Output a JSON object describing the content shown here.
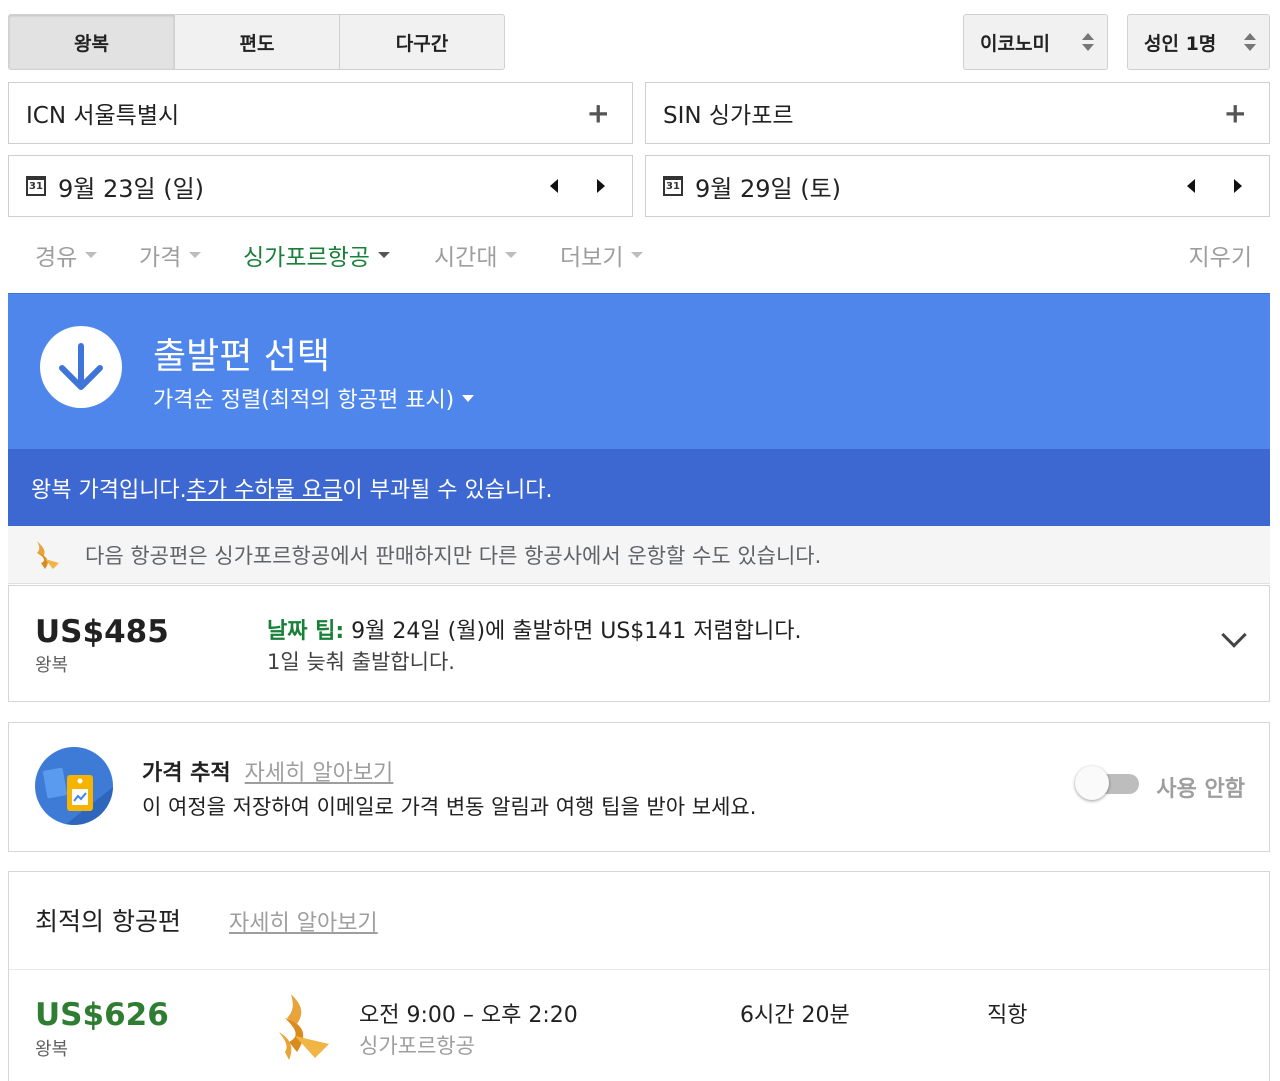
{
  "trip_tabs": [
    "왕복",
    "편도",
    "다구간"
  ],
  "cabin": "이코노미",
  "passengers": "성인 1명",
  "origin": "ICN 서울특별시",
  "destination": "SIN 싱가포르",
  "depart_date": "9월 23일 (일)",
  "return_date": "9월 29일 (토)",
  "calendar_icon_text": "31",
  "filters": [
    "경유",
    "가격",
    "싱가포르항공",
    "시간대",
    "더보기"
  ],
  "clear_label": "지우기",
  "banner": {
    "title": "출발편 선택",
    "sort": "가격순 정렬(최적의 항공편 표시)"
  },
  "subbanner": {
    "pre": "왕복 가격입니다. ",
    "link": "추가 수하물 요금",
    "post": "이 부과될 수 있습니다."
  },
  "notice": "다음 항공편은 싱가포르항공에서 판매하지만 다른 항공사에서 운항할 수도 있습니다.",
  "tip_card": {
    "price": "US$485",
    "price_sub": "왕복",
    "tip_label": "날짜 팁:",
    "tip_text": " 9월 24일 (월)에 출발하면 US$141 저렴합니다.",
    "tip_line2": "1일 늦춰 출발합니다."
  },
  "tracking": {
    "title": "가격 추적",
    "learn_more": "자세히 알아보기",
    "desc": "이 여정을 저장하여 이메일로 가격 변동 알림과 여행 팁을 받아 보세요.",
    "toggle_label": "사용 안함",
    "enabled": false
  },
  "best": {
    "title": "최적의 항공편",
    "learn_more": "자세히 알아보기",
    "flights": [
      {
        "price": "US$626",
        "price_sub": "왕복",
        "times": "오전 9:00 – 오후 2:20",
        "airline": "싱가포르항공",
        "duration": "6시간 20분",
        "stops": "직항"
      }
    ]
  },
  "colors": {
    "banner_blue": "#4f86ec",
    "subbanner_blue": "#3e68d1",
    "green": "#188038",
    "price_green": "#2e7d32"
  }
}
